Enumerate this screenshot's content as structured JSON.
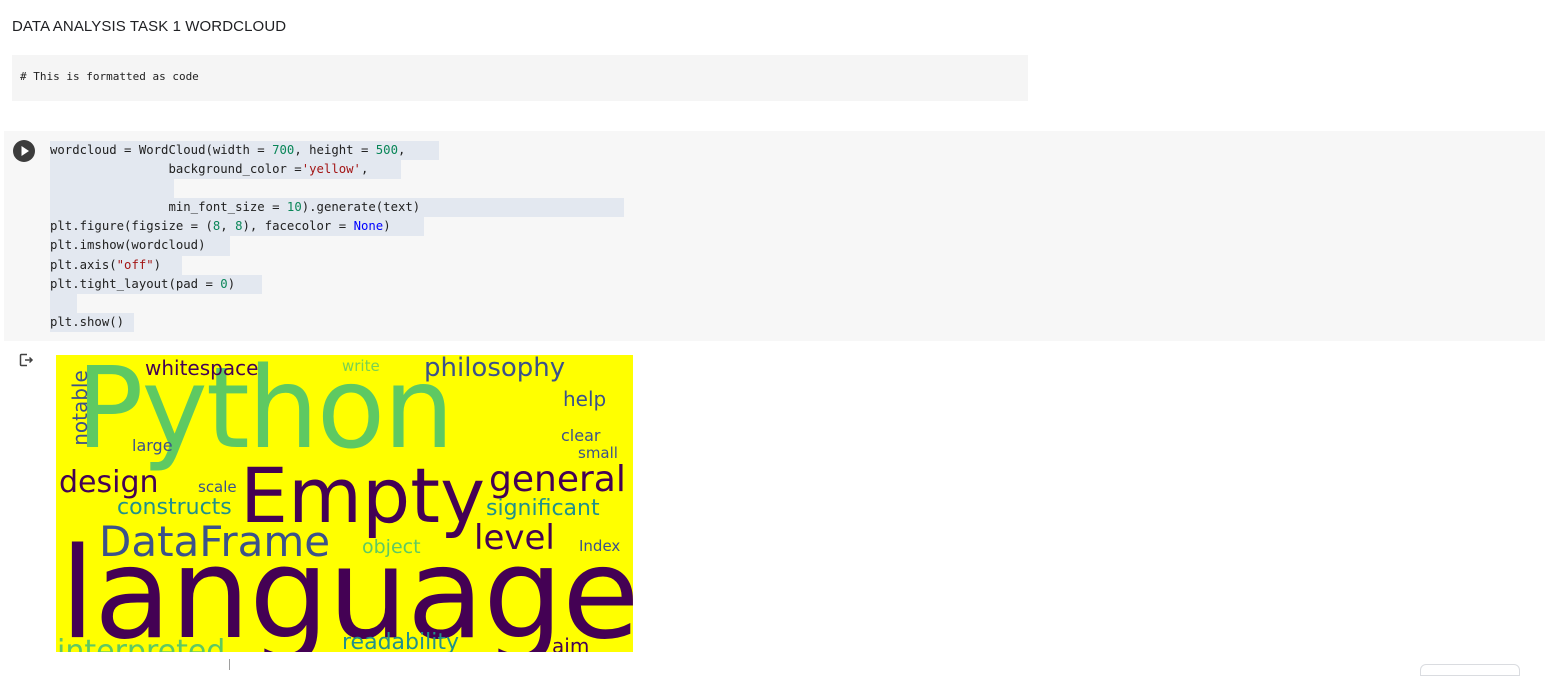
{
  "heading": "DATA ANALYSIS TASK 1 WORDCLOUD",
  "md_code": "# This is formatted as code",
  "code": {
    "l1a": "wordcloud = WordCloud(width = ",
    "l1b": "700",
    "l1c": ", height = ",
    "l1d": "500",
    "l1e": ",",
    "l2a": "                background_color =",
    "l2b": "'yellow'",
    "l2c": ",",
    "l4a": "                min_font_size = ",
    "l4b": "10",
    "l4c": ").generate(text)",
    "l5a": "plt.figure(figsize = (",
    "l5b": "8",
    "l5c": ", ",
    "l5d": "8",
    "l5e": "), facecolor = ",
    "l5f": "None",
    "l5g": ")",
    "l6": "plt.imshow(wordcloud)",
    "l7a": "plt.axis(",
    "l7b": "\"off\"",
    "l7c": ")",
    "l8a": "plt.tight_layout(pad = ",
    "l8b": "0",
    "l8c": ")",
    "l10": "plt.show()"
  },
  "colors": {
    "wc_background": "#ffff00",
    "viridis_dark": "#440154",
    "viridis_blue": "#3b528b",
    "viridis_teal": "#21918c",
    "viridis_green": "#5ec962",
    "viridis_lime": "#7ad151"
  },
  "wordcloud": {
    "python": "Python",
    "language": "language",
    "empty": "Empty",
    "dataframe": "DataFrame",
    "general": "general",
    "level": "level",
    "design": "design",
    "significant": "significant",
    "constructs": "constructs",
    "philosophy": "philosophy",
    "whitespace": "whitespace",
    "notable": "notable",
    "object": "object",
    "readability": "readability",
    "help": "help",
    "large": "large",
    "clear": "clear",
    "small": "small",
    "scale": "scale",
    "write": "write",
    "index": "Index",
    "interpreted": "interpreted",
    "aim": "aim"
  }
}
